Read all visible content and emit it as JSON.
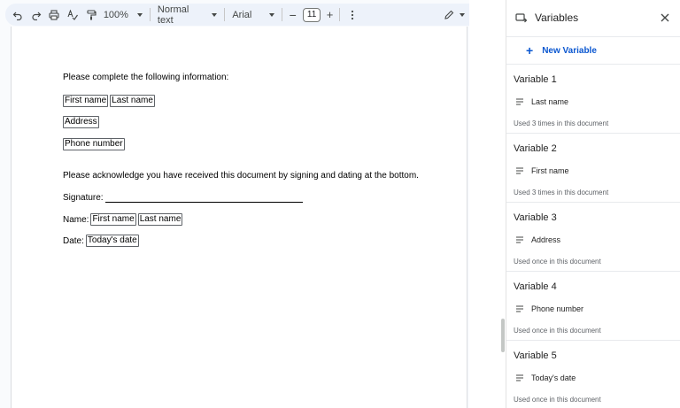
{
  "toolbar": {
    "zoom": "100%",
    "style": "Normal text",
    "font": "Arial",
    "font_size": "11"
  },
  "document": {
    "intro": "Please complete the following information:",
    "first_name_chip": "First name",
    "last_name_chip": "Last name",
    "address_chip": "Address",
    "phone_chip": "Phone number",
    "acknowledge": "Please acknowledge you have received this document by signing and dating at the bottom.",
    "signature_label": "Signature:",
    "name_label": "Name:",
    "date_label": "Date:",
    "date_chip": "Today's date"
  },
  "panel": {
    "title": "Variables",
    "new_variable": "New Variable",
    "variables": [
      {
        "name": "Variable 1",
        "value": "Last name",
        "usage": "Used 3 times in this document"
      },
      {
        "name": "Variable 2",
        "value": "First name",
        "usage": "Used 3 times in this document"
      },
      {
        "name": "Variable 3",
        "value": "Address",
        "usage": "Used once in this document"
      },
      {
        "name": "Variable 4",
        "value": "Phone number",
        "usage": "Used once in this document"
      },
      {
        "name": "Variable 5",
        "value": "Today's date",
        "usage": "Used once in this document"
      }
    ]
  }
}
